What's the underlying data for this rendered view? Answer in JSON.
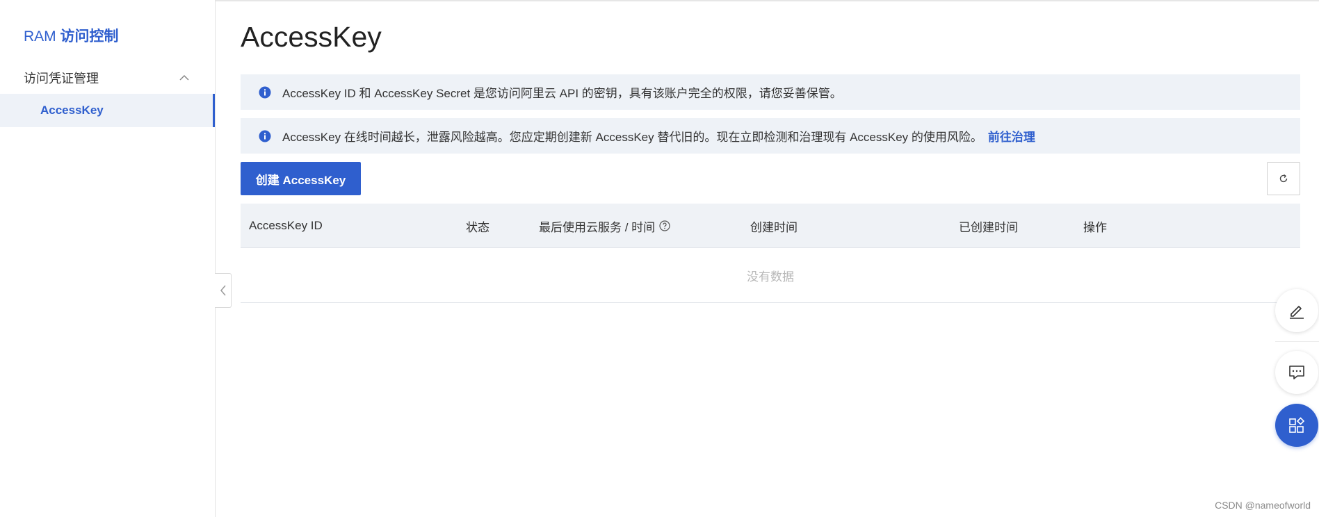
{
  "sidebar": {
    "title_prefix": "RAM ",
    "title_main": "访问控制",
    "group_label": "访问凭证管理",
    "active_item_label": "AccessKey"
  },
  "main": {
    "page_title": "AccessKey",
    "notice_1": "AccessKey ID 和 AccessKey Secret 是您访问阿里云 API 的密钥，具有该账户完全的权限，请您妥善保管。",
    "notice_2": "AccessKey 在线时间越长，泄露风险越高。您应定期创建新 AccessKey 替代旧的。现在立即检测和治理现有 AccessKey 的使用风险。",
    "notice_2_link": "前往治理",
    "create_button_label": "创建 AccessKey",
    "table": {
      "columns": [
        "AccessKey ID",
        "状态",
        "最后使用云服务 / 时间",
        "创建时间",
        "已创建时间",
        "操作"
      ],
      "empty_text": "没有数据"
    }
  },
  "icons": {
    "info": "info-icon",
    "chevron": "chevron-up-icon",
    "collapse": "chevron-left-icon",
    "refresh": "refresh-icon",
    "question": "question-icon",
    "edit": "edit-icon",
    "chat": "chat-icon",
    "apps": "apps-icon"
  },
  "colors": {
    "accent": "#2f5fce",
    "notice_bg": "#eef2f7",
    "table_header_bg": "#eff2f6"
  },
  "watermark": "CSDN @nameofworld"
}
